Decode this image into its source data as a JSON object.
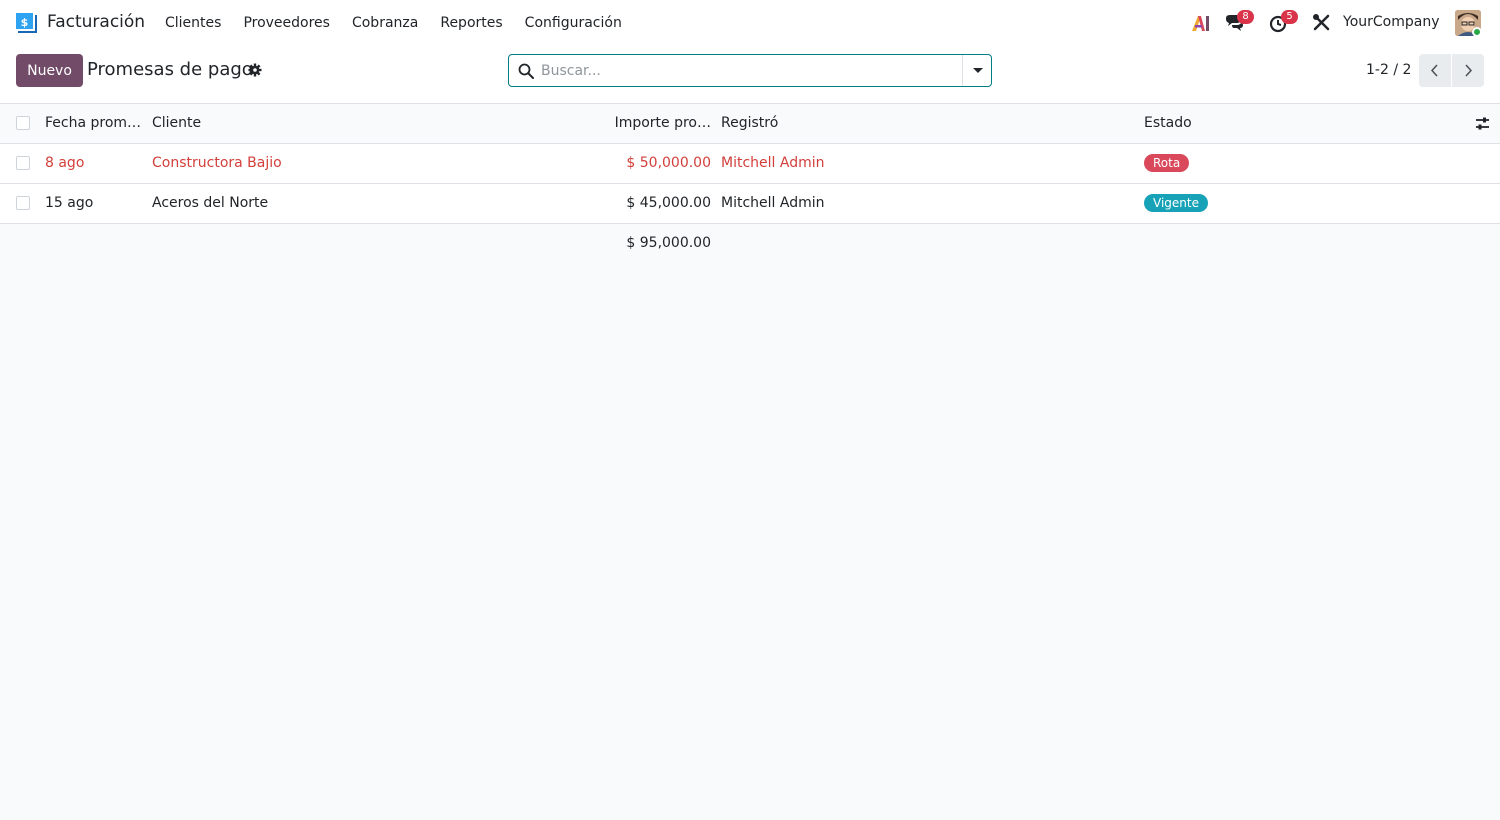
{
  "navbar": {
    "app_name": "Facturación",
    "menu": [
      "Clientes",
      "Proveedores",
      "Cobranza",
      "Reportes",
      "Configuración"
    ],
    "chat_badge": "8",
    "activity_badge": "5",
    "company": "YourCompany"
  },
  "control": {
    "new_label": "Nuevo",
    "title": "Promesas de pago",
    "search_placeholder": "Buscar...",
    "pager": "1-2 / 2"
  },
  "table": {
    "columns": {
      "date": "Fecha prom…",
      "client": "Cliente",
      "amount": "Importe pro…",
      "registered": "Registró",
      "state": "Estado"
    },
    "rows": [
      {
        "date": "8 ago",
        "client": "Constructora Bajio",
        "amount": "$ 50,000.00",
        "registered": "Mitchell Admin",
        "state": "Rota"
      },
      {
        "date": "15 ago",
        "client": "Aceros del Norte",
        "amount": "$ 45,000.00",
        "registered": "Mitchell Admin",
        "state": "Vigente"
      }
    ],
    "total": "$ 95,000.00"
  },
  "colors": {
    "brand": "#714b67",
    "overdue": "#d23f3a",
    "tag_rota": "#d9485b",
    "tag_vigente": "#17a2b8"
  }
}
